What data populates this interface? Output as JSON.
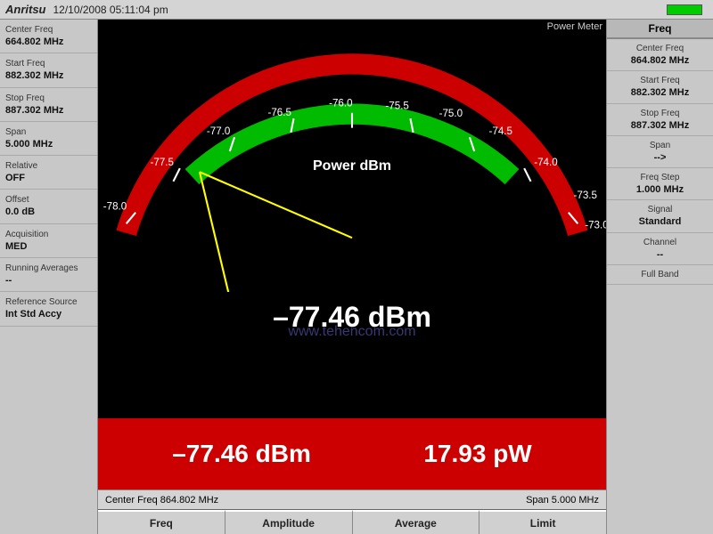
{
  "topbar": {
    "logo": "Anritsu",
    "datetime": "12/10/2008  05:11:04 pm"
  },
  "left_sidebar": {
    "items": [
      {
        "label": "Center Freq",
        "value": "664.802 MHz"
      },
      {
        "label": "Start Freq",
        "value": "882.302 MHz"
      },
      {
        "label": "Stop Freq",
        "value": "887.302 MHz"
      },
      {
        "label": "Span",
        "value": "5.000 MHz"
      },
      {
        "label": "Relative",
        "value": "OFF"
      },
      {
        "label": "Offset",
        "value": "0.0 dB"
      },
      {
        "label": "Acquisition",
        "value": "MED"
      },
      {
        "label": "Running Averages",
        "value": "--"
      },
      {
        "label": "Reference Source",
        "value": "Int Std Accy"
      }
    ]
  },
  "power_meter_label": "Power Meter",
  "gauge": {
    "ticks": [
      "-78.0",
      "-77.5",
      "-77.0",
      "-76.5",
      "-76.0",
      "-75.5",
      "-75.0",
      "-74.5",
      "-74.0",
      "-73.5",
      "-73.0"
    ],
    "power_label": "Power dBm",
    "main_reading": "–77.46 dBm"
  },
  "red_section": {
    "dbm_value": "–77.46 dBm",
    "pw_value": "17.93 pW"
  },
  "watermark": "www.tehencom.com",
  "status_bar": {
    "left": "Center Freq  864.802 MHz",
    "right": "Span 5.000 MHz"
  },
  "bottom_tabs": [
    {
      "label": "Freq"
    },
    {
      "label": "Amplitude"
    },
    {
      "label": "Average"
    },
    {
      "label": "Limit"
    }
  ],
  "right_sidebar": {
    "header": "Freq",
    "items": [
      {
        "label": "Center Freq",
        "value": "864.802 MHz"
      },
      {
        "label": "Start Freq",
        "value": "882.302 MHz"
      },
      {
        "label": "Stop Freq",
        "value": "887.302 MHz"
      },
      {
        "label": "Span",
        "value": "-->"
      },
      {
        "label": "Freq Step",
        "value": "1.000 MHz"
      },
      {
        "label": "Signal",
        "value": "Standard"
      },
      {
        "label": "Channel",
        "value": "--"
      },
      {
        "label": "Full Band",
        "value": ""
      }
    ]
  }
}
